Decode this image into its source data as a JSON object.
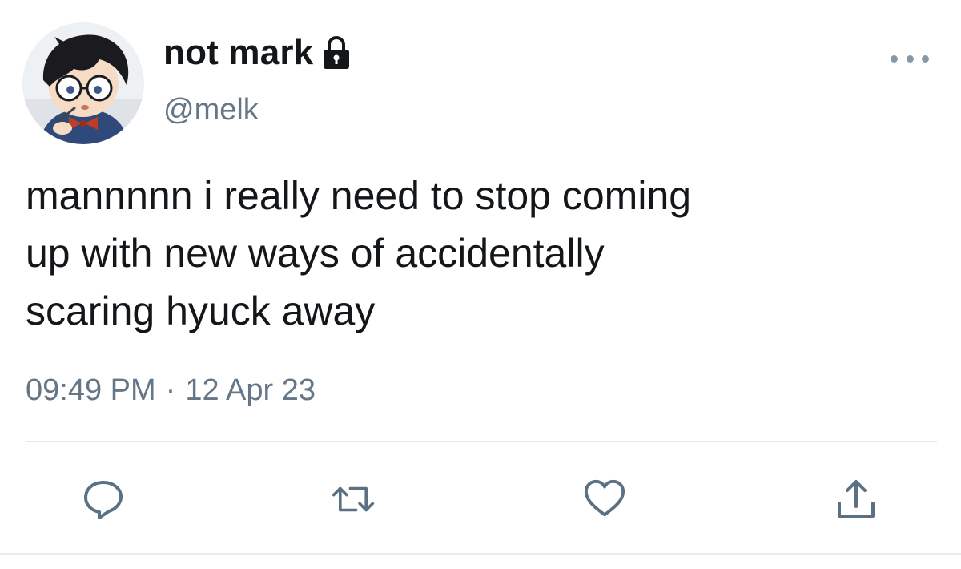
{
  "tweet": {
    "display_name": "not mark",
    "handle": "@melk",
    "text": "mannnnn i really need to stop coming\nup with new ways of accidentally\nscaring hyuck away",
    "time": "09:49 PM",
    "separator": "·",
    "date": "12 Apr 23"
  },
  "icons": {
    "lock": "lock-icon",
    "more": "more-icon",
    "reply": "reply-icon",
    "retweet": "retweet-icon",
    "like": "heart-icon",
    "share": "share-icon"
  },
  "colors": {
    "text": "#14171a",
    "secondary": "#657786",
    "icon": "#5b7083",
    "divider": "#e1e8ed"
  }
}
